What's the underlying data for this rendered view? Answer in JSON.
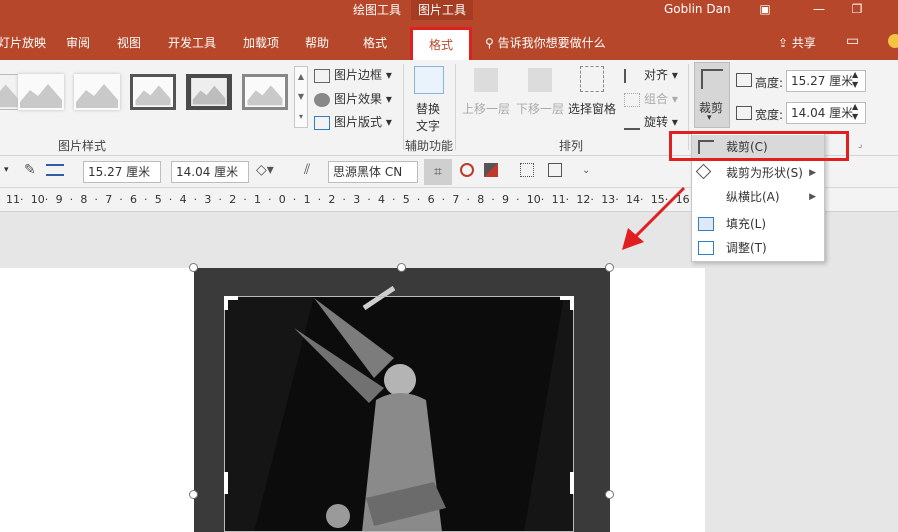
{
  "titlebar": {
    "context_groups": [
      "绘图工具",
      "图片工具"
    ],
    "user": "Goblin Dan",
    "icons": [
      "ribbon-display-icon",
      "minimize-icon",
      "restore-icon"
    ],
    "tabs": [
      "灯片放映",
      "审阅",
      "视图",
      "开发工具",
      "加载项",
      "帮助",
      "格式",
      "格式"
    ],
    "active_tab": "格式",
    "tell_me": "告诉我你想要做什么",
    "share": "共享"
  },
  "ribbon": {
    "picture_styles_group": "图片样式",
    "picture_border": "图片边框",
    "picture_effects": "图片效果",
    "picture_layout": "图片版式",
    "alt_text_line1": "替换",
    "alt_text_line2": "文字",
    "accessibility_group": "辅助功能",
    "bring_forward": "上移一层",
    "send_backward": "下移一层",
    "selection_pane": "选择窗格",
    "align": "对齐",
    "group": "组合",
    "rotate": "旋转",
    "arrange_group": "排列",
    "crop": "裁剪",
    "height_label": "高度:",
    "height_value": "15.27 厘米",
    "width_label": "宽度:",
    "width_value": "14.04 厘米"
  },
  "toolbar2": {
    "height_value": "15.27 厘米",
    "width_value": "14.04 厘米",
    "font": "思源黑体 CN"
  },
  "ruler": {
    "labels": [
      "11",
      "10",
      "9",
      "8",
      "7",
      "6",
      "5",
      "4",
      "3",
      "2",
      "1",
      "0",
      "1",
      "2",
      "3",
      "4",
      "5",
      "6",
      "7",
      "8",
      "9",
      "10",
      "11",
      "12",
      "13",
      "14",
      "15",
      "16"
    ]
  },
  "crop_menu": {
    "items": [
      "裁剪(C)",
      "裁剪为形状(S)",
      "纵横比(A)",
      "填充(L)",
      "调整(T)"
    ]
  },
  "colors": {
    "accent": "#b7472a",
    "highlight": "#e02020"
  }
}
